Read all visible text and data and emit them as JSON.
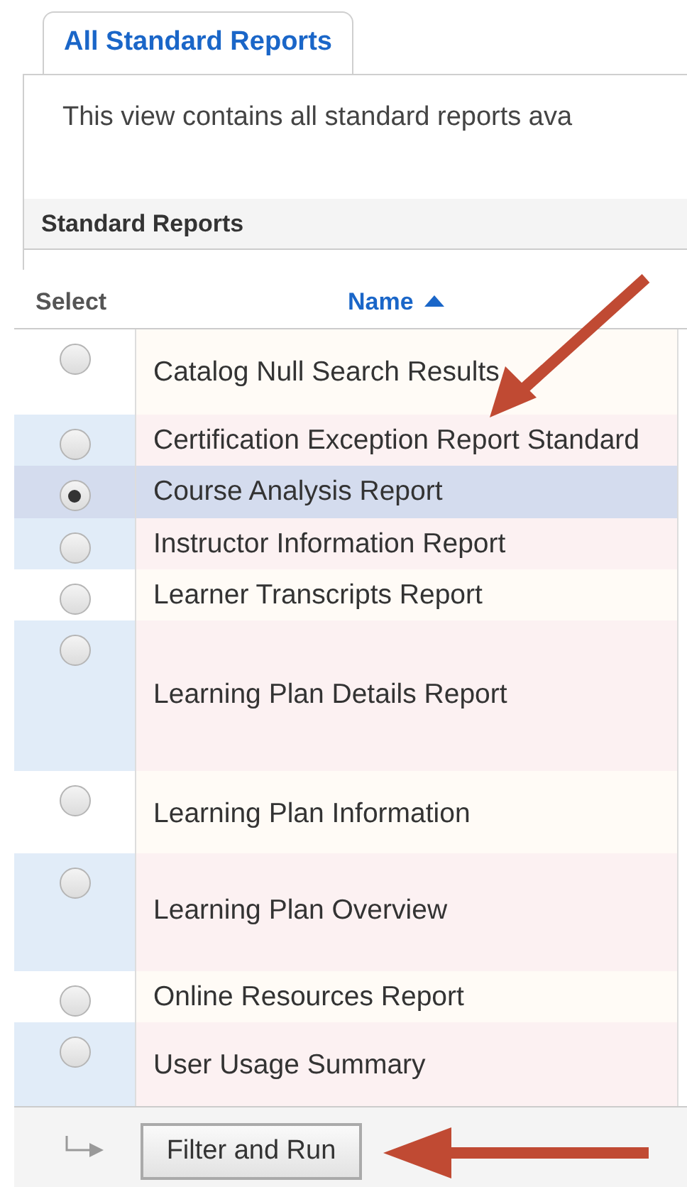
{
  "tabs": [
    {
      "label": "All Standard Reports",
      "selected": true
    }
  ],
  "description": "This view contains all standard reports ava",
  "section_title": "Standard Reports",
  "table": {
    "columns": [
      {
        "label": "Select"
      },
      {
        "label": "Name",
        "sorted_ascending": true
      }
    ],
    "rows": [
      {
        "name": "Catalog Null Search Results",
        "selected": false
      },
      {
        "name": "Certification Exception Report Standard",
        "selected": false
      },
      {
        "name": "Course Analysis Report",
        "selected": true
      },
      {
        "name": "Instructor Information Report",
        "selected": false
      },
      {
        "name": "Learner Transcripts Report",
        "selected": false
      },
      {
        "name": "Learning Plan Details Report",
        "selected": false
      },
      {
        "name": "Learning Plan Information",
        "selected": false
      },
      {
        "name": "Learning Plan Overview",
        "selected": false
      },
      {
        "name": "Online Resources Report",
        "selected": false
      },
      {
        "name": "User Usage Summary",
        "selected": false
      }
    ]
  },
  "footer": {
    "button": "Filter and Run"
  }
}
